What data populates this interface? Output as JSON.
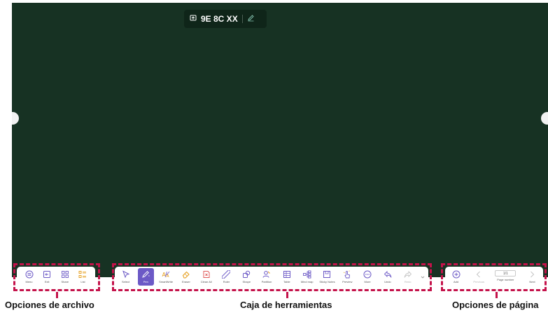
{
  "board": {
    "header": {
      "code": "9E 8C XX",
      "icons": [
        "share-screen-icon",
        "edit-icon"
      ]
    }
  },
  "file_options": {
    "caption": "Opciones de archivo",
    "items": [
      {
        "label": "Menu",
        "icon": "menu-icon"
      },
      {
        "label": "Exit",
        "icon": "exit-icon"
      },
      {
        "label": "Share",
        "icon": "share-icon"
      },
      {
        "label": "List",
        "icon": "list-icon"
      }
    ]
  },
  "toolbox": {
    "caption": "Caja de herramientas",
    "items": [
      {
        "label": "Select",
        "icon": "select-cursor-icon"
      },
      {
        "label": "Pen",
        "icon": "pen-icon",
        "active": true
      },
      {
        "label": "SmartWrite",
        "icon": "smartwrite-icon"
      },
      {
        "label": "Eraser",
        "icon": "eraser-icon"
      },
      {
        "label": "Clean All",
        "icon": "clean-all-icon"
      },
      {
        "label": "Ruler",
        "icon": "ruler-icon"
      },
      {
        "label": "Shape",
        "icon": "shape-icon"
      },
      {
        "label": "Partition",
        "icon": "partition-icon"
      },
      {
        "label": "Table",
        "icon": "table-icon"
      },
      {
        "label": "Mind map",
        "icon": "mind-map-icon"
      },
      {
        "label": "Sticky Notes",
        "icon": "sticky-notes-icon"
      },
      {
        "label": "Preview",
        "icon": "preview-icon"
      },
      {
        "label": "More",
        "icon": "more-icon"
      },
      {
        "label": "Undo",
        "icon": "undo-icon"
      },
      {
        "label": "Redo",
        "icon": "redo-icon",
        "disabled": true
      }
    ]
  },
  "page_options": {
    "caption": "Opciones de página",
    "add_label": "Add",
    "previous_label": "Previous",
    "page_number_value": "1/1",
    "page_number_label": "Page number",
    "next_label": "Next"
  },
  "colors": {
    "board": "#173223",
    "accent": "#6c59c6",
    "callout": "#c4124a"
  }
}
